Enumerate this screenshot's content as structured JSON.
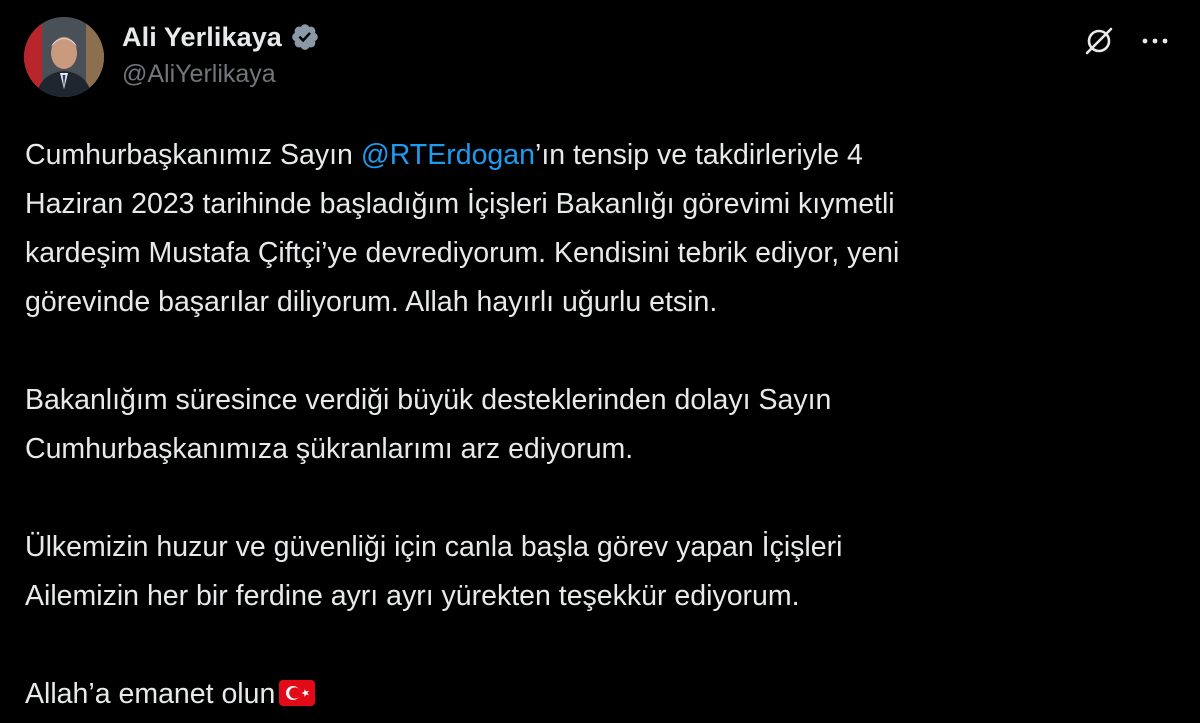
{
  "author": {
    "display_name": "Ali Yerlikaya",
    "handle": "@AliYerlikaya",
    "verified": true,
    "avatar_icon": "profile-photo"
  },
  "actions": {
    "grok_icon": "grok-icon",
    "more_icon": "more-options-icon"
  },
  "tweet": {
    "p1_a": "Cumhurbaşkanımız Sayın ",
    "p1_mention": "@RTErdogan",
    "p1_b": "’ın tensip ve takdirleriyle 4",
    "p1_line2": "Haziran 2023 tarihinde başladığım İçişleri Bakanlığı görevimi kıymetli",
    "p1_line3": "kardeşim Mustafa Çiftçi’ye devrediyorum. Kendisini tebrik ediyor, yeni",
    "p1_line4": "görevinde başarılar diliyorum. Allah hayırlı uğurlu etsin.",
    "p2_line1": "Bakanlığım süresince verdiği büyük desteklerinden dolayı Sayın",
    "p2_line2": "Cumhurbaşkanımıza şükranlarımı arz ediyorum.",
    "p3_line1": "Ülkemizin huzur ve güvenliği için canla başla görev yapan İçişleri",
    "p3_line2": "Ailemizin her bir ferdine ayrı ayrı yürekten teşekkür ediyorum.",
    "p4_line1": "Allah’a emanet olun",
    "flag_emoji": "turkey-flag"
  },
  "colors": {
    "background": "#000000",
    "text": "#e7e9ea",
    "secondary": "#71767b",
    "mention": "#1d9bf0",
    "flag_red": "#e30a17"
  }
}
